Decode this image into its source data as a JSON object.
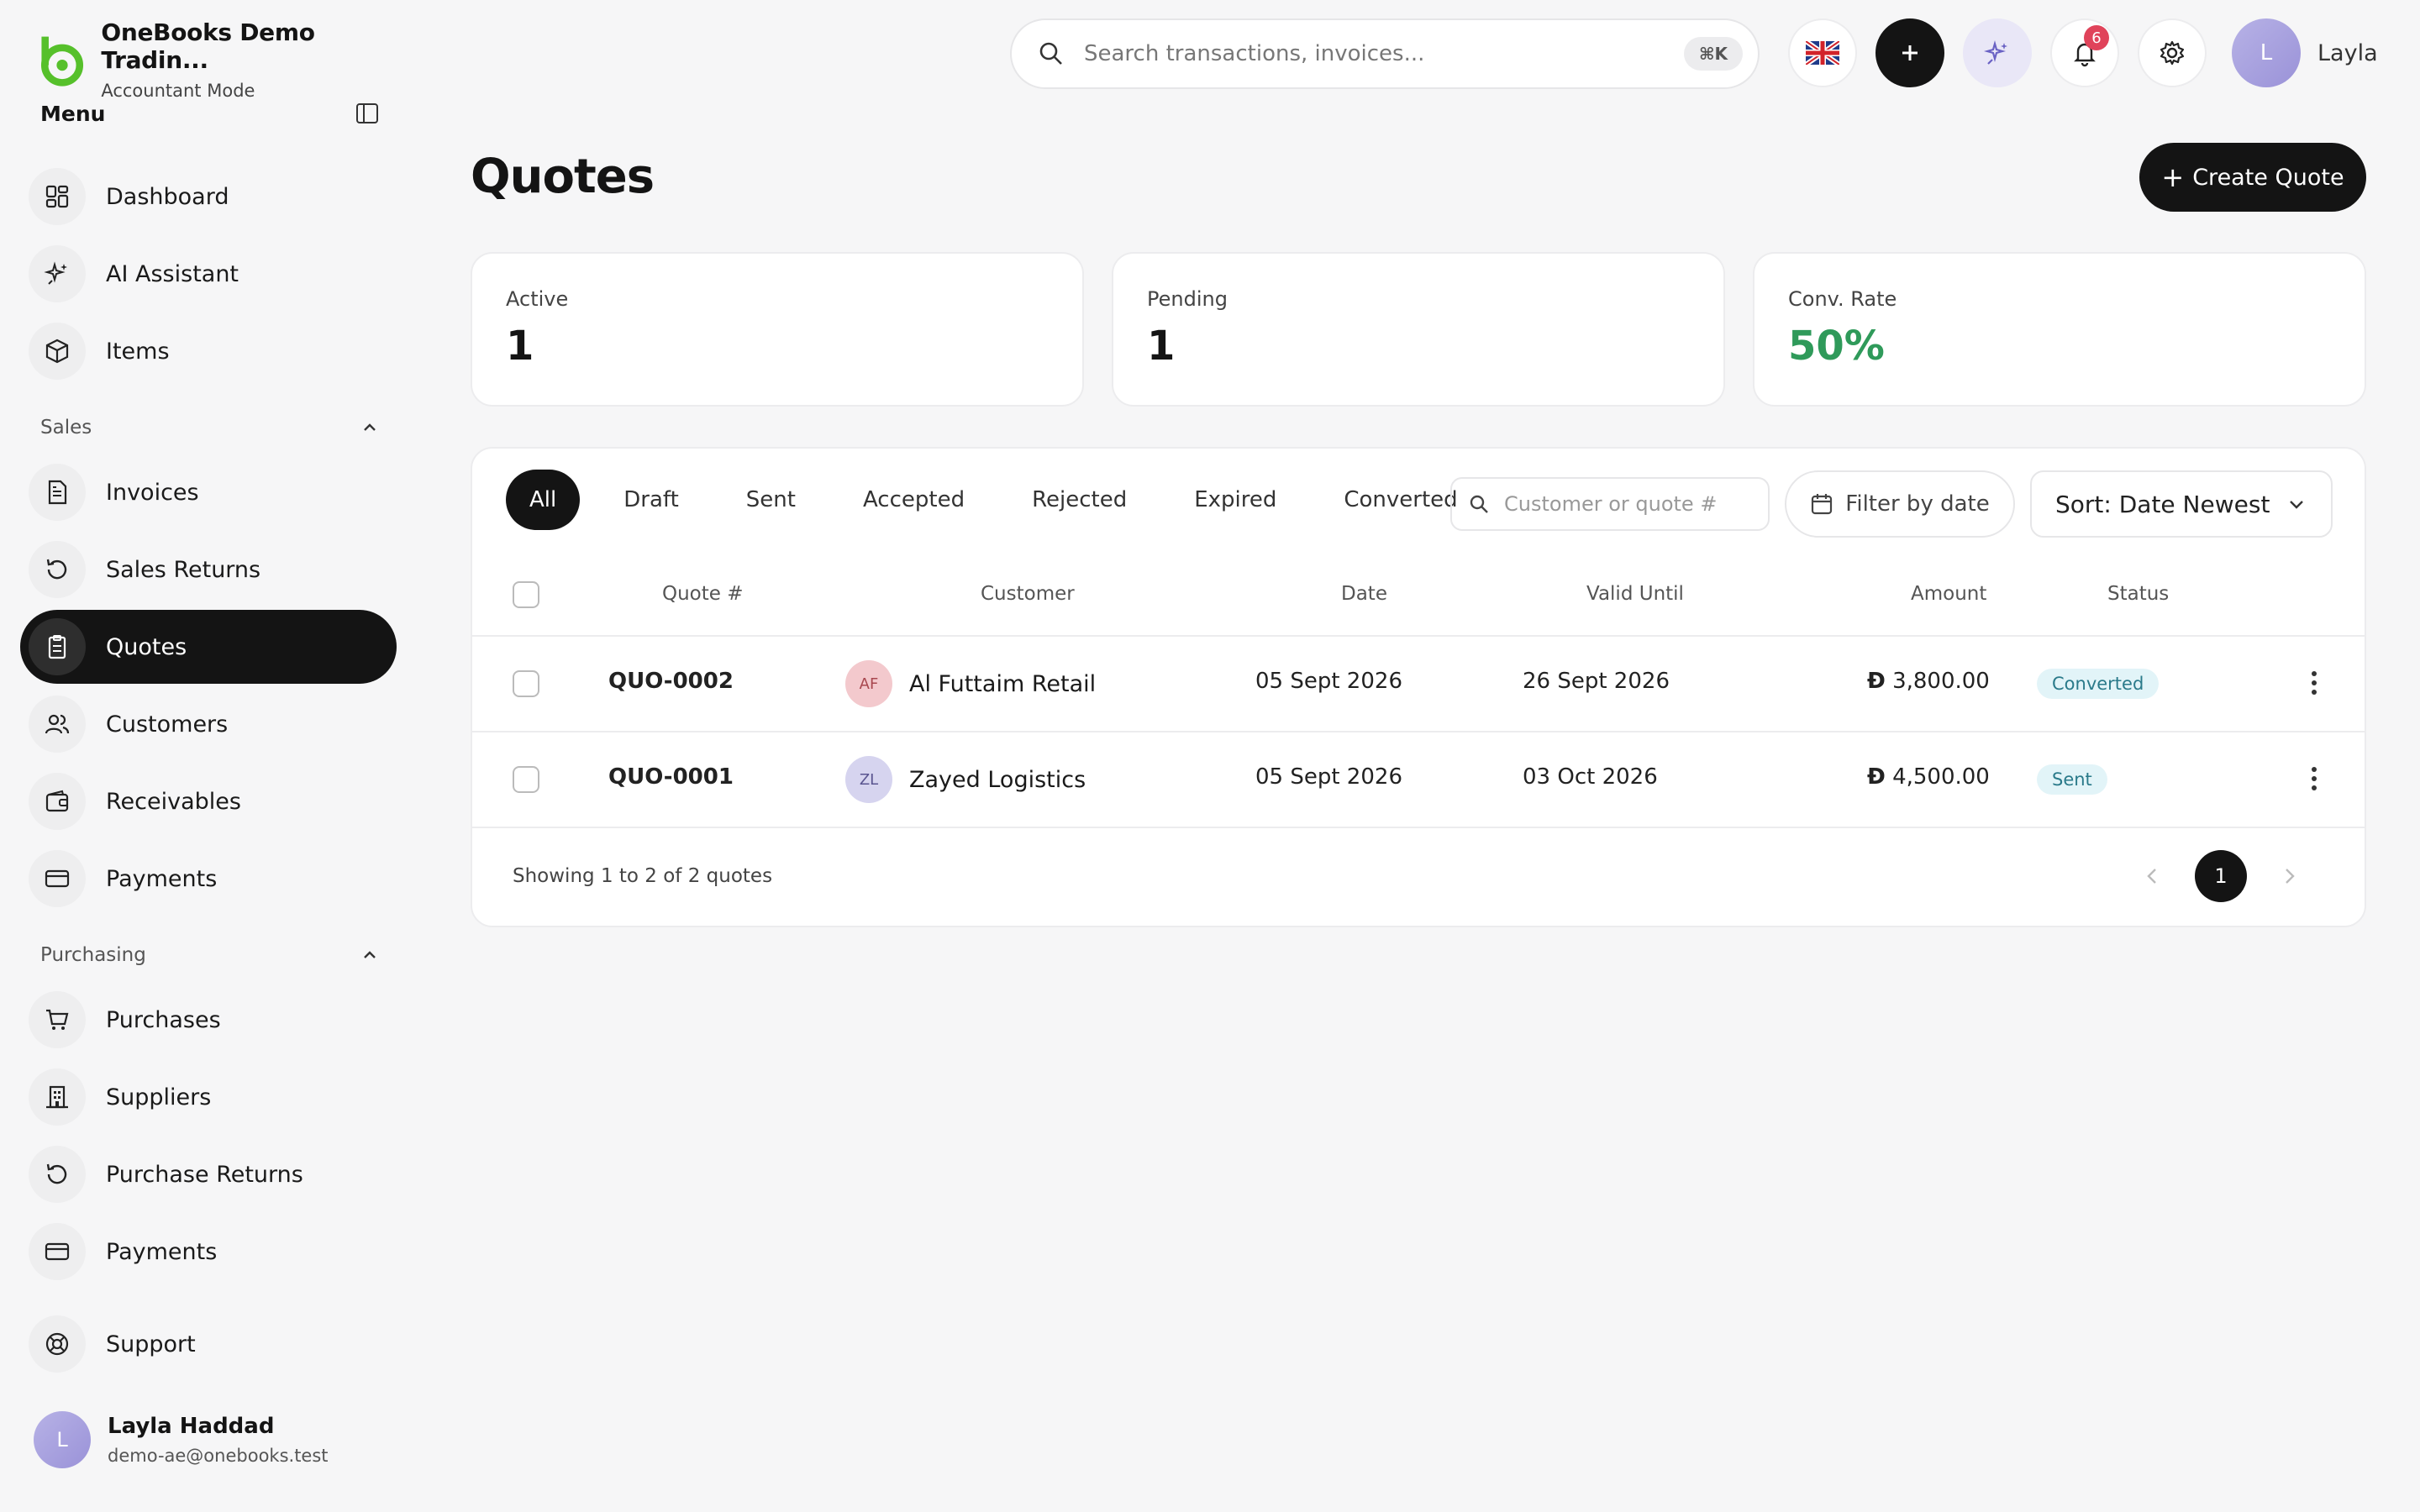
{
  "brand": {
    "name": "OneBooks Demo Tradin...",
    "mode": "Accountant Mode"
  },
  "menu": {
    "title": "Menu"
  },
  "nav": {
    "top": [
      {
        "label": "Dashboard",
        "icon": "dashboard-icon"
      },
      {
        "label": "AI Assistant",
        "icon": "sparkle-icon"
      },
      {
        "label": "Items",
        "icon": "box-icon"
      }
    ],
    "sales_title": "Sales",
    "sales": [
      {
        "label": "Invoices",
        "icon": "invoice-icon"
      },
      {
        "label": "Sales Returns",
        "icon": "return-icon"
      },
      {
        "label": "Quotes",
        "icon": "clipboard-icon",
        "active": true
      },
      {
        "label": "Customers",
        "icon": "users-icon"
      },
      {
        "label": "Receivables",
        "icon": "wallet-icon"
      },
      {
        "label": "Payments",
        "icon": "card-icon"
      }
    ],
    "purchasing_title": "Purchasing",
    "purchasing": [
      {
        "label": "Purchases",
        "icon": "cart-icon"
      },
      {
        "label": "Suppliers",
        "icon": "building-icon"
      },
      {
        "label": "Purchase Returns",
        "icon": "return-icon"
      },
      {
        "label": "Payments",
        "icon": "card-icon"
      }
    ],
    "support": {
      "label": "Support",
      "icon": "lifebuoy-icon"
    }
  },
  "user": {
    "initial": "L",
    "name": "Layla Haddad",
    "email": "demo-ae@onebooks.test",
    "short_name": "Layla"
  },
  "search": {
    "placeholder": "Search transactions, invoices...",
    "shortcut": "⌘K"
  },
  "notifications": {
    "count": "6"
  },
  "page": {
    "title": "Quotes",
    "create_label": "Create Quote"
  },
  "stats": [
    {
      "label": "Active",
      "value": "1"
    },
    {
      "label": "Pending",
      "value": "1"
    },
    {
      "label": "Conv. Rate",
      "value": "50%"
    }
  ],
  "tabs": [
    "All",
    "Draft",
    "Sent",
    "Accepted",
    "Rejected",
    "Expired",
    "Converted"
  ],
  "filters": {
    "search_placeholder": "Customer or quote #",
    "date_label": "Filter by date",
    "sort_label": "Sort: Date Newest"
  },
  "table": {
    "headers": [
      "Quote #",
      "Customer",
      "Date",
      "Valid Until",
      "Amount",
      "Status"
    ],
    "rows": [
      {
        "quote": "QUO-0002",
        "initials": "AF",
        "customer": "Al Futtaim Retail",
        "date": "05 Sept 2026",
        "valid": "26 Sept 2026",
        "amount": "3,800.00",
        "currency": "Ð",
        "status": "Converted",
        "avatar_bg": "#f3c9cd",
        "avatar_fg": "#a8474f"
      },
      {
        "quote": "QUO-0001",
        "initials": "ZL",
        "customer": "Zayed Logistics",
        "date": "05 Sept 2026",
        "valid": "03 Oct 2026",
        "amount": "4,500.00",
        "currency": "Ð",
        "status": "Sent",
        "avatar_bg": "#d6d4ef",
        "avatar_fg": "#5a5590"
      }
    ]
  },
  "footer": {
    "showing": "Showing 1 to 2 of 2 quotes",
    "page": "1"
  }
}
